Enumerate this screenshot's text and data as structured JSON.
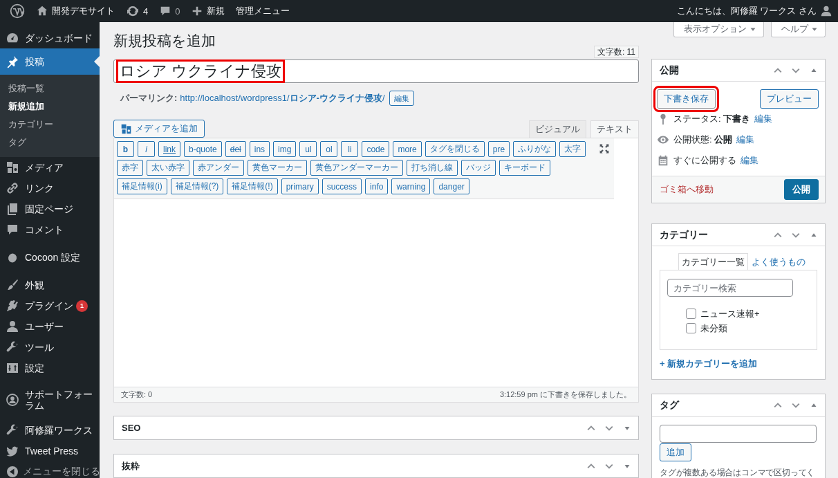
{
  "admin_bar": {
    "site_name": "開発デモサイト",
    "updates": "4",
    "comments": "0",
    "new": "新規",
    "admin_menu": "管理メニュー",
    "greeting": "こんにちは、阿修羅 ワークス さん"
  },
  "sidebar": {
    "items": [
      {
        "label": "ダッシュボード",
        "selected": false
      },
      {
        "label": "投稿",
        "selected": true,
        "children": [
          {
            "label": "投稿一覧",
            "selected": false
          },
          {
            "label": "新規追加",
            "selected": true
          },
          {
            "label": "カテゴリー",
            "selected": false
          },
          {
            "label": "タグ",
            "selected": false
          }
        ]
      },
      {
        "label": "メディア",
        "selected": false
      },
      {
        "label": "リンク",
        "selected": false
      },
      {
        "label": "固定ページ",
        "selected": false
      },
      {
        "label": "コメント",
        "selected": false
      },
      {
        "label": "Cocoon 設定",
        "selected": false
      },
      {
        "label": "外観",
        "selected": false
      },
      {
        "label": "プラグイン",
        "selected": false,
        "badge": "1"
      },
      {
        "label": "ユーザー",
        "selected": false
      },
      {
        "label": "ツール",
        "selected": false
      },
      {
        "label": "設定",
        "selected": false
      },
      {
        "label": "サポートフォーラム",
        "selected": false
      },
      {
        "label": "阿修羅ワークス",
        "selected": false
      },
      {
        "label": "Tweet Press",
        "selected": false
      },
      {
        "label": "メニューを閉じる",
        "selected": false
      }
    ]
  },
  "screen_options": [
    "表示オプション",
    "ヘルプ"
  ],
  "page_title": "新規投稿を追加",
  "title_field": {
    "char_count": "文字数: 11",
    "value": "ロシア ウクライナ侵攻",
    "highlighted": true
  },
  "permalink": {
    "label": "パーマリンク:",
    "url": "http://localhost/wordpress1/**ロシア-ウクライナ侵攻**/",
    "edit": "編集"
  },
  "add_media": "メディアを追加",
  "editor_tabs": [
    {
      "label": "ビジュアル",
      "selected": false
    },
    {
      "label": "テキスト",
      "selected": true
    }
  ],
  "quicktags": [
    {
      "label": "b",
      "kind": "bold"
    },
    {
      "label": "i",
      "kind": "italic"
    },
    {
      "label": "link",
      "kind": "underline"
    },
    {
      "label": "b-quote",
      "kind": "plain"
    },
    {
      "label": "del",
      "kind": "strike"
    },
    {
      "label": "ins",
      "kind": "plain"
    },
    {
      "label": "img",
      "kind": "plain"
    },
    {
      "label": "ul",
      "kind": "plain"
    },
    {
      "label": "ol",
      "kind": "plain"
    },
    {
      "label": "li",
      "kind": "plain"
    },
    {
      "label": "code",
      "kind": "plain"
    },
    {
      "label": "more",
      "kind": "plain"
    },
    {
      "label": "タグを閉じる",
      "kind": "plain"
    },
    {
      "label": "pre",
      "kind": "plain"
    },
    {
      "label": "ふりがな",
      "kind": "plain"
    },
    {
      "label": "太字",
      "kind": "plain"
    },
    {
      "label": "赤字",
      "kind": "plain"
    },
    {
      "label": "太い赤字",
      "kind": "plain"
    },
    {
      "label": "赤アンダー",
      "kind": "plain"
    },
    {
      "label": "黄色マーカー",
      "kind": "plain"
    },
    {
      "label": "黄色アンダーマーカー",
      "kind": "plain"
    },
    {
      "label": "打ち消し線",
      "kind": "plain"
    },
    {
      "label": "バッジ",
      "kind": "plain"
    },
    {
      "label": "キーボード",
      "kind": "plain"
    },
    {
      "label": "補足情報(i)",
      "kind": "plain"
    },
    {
      "label": "補足情報(?)",
      "kind": "plain"
    },
    {
      "label": "補足情報(!)",
      "kind": "plain"
    },
    {
      "label": "primary",
      "kind": "plain"
    },
    {
      "label": "success",
      "kind": "plain"
    },
    {
      "label": "info",
      "kind": "plain"
    },
    {
      "label": "warning",
      "kind": "plain"
    },
    {
      "label": "danger",
      "kind": "plain"
    }
  ],
  "word_count": "文字数: 0",
  "autosave": "3:12:59 pm に下書きを保存しました。",
  "postboxes": [
    {
      "title": "SEO"
    },
    {
      "title": "抜粋"
    }
  ],
  "publish": {
    "title": "公開",
    "save_draft": "下書き保存",
    "save_draft_highlighted": true,
    "preview": "プレビュー",
    "rows": [
      {
        "label": "ステータス:",
        "value": "下書き",
        "edit": "編集"
      },
      {
        "label": "公開状態:",
        "value": "公開",
        "edit": "編集"
      },
      {
        "label": "すぐに公開する",
        "edit": "編集"
      }
    ],
    "trash": "ゴミ箱へ移動",
    "publish": "公開"
  },
  "categories": {
    "title": "カテゴリー",
    "tabs": [
      {
        "label": "カテゴリー一覧",
        "selected": true
      },
      {
        "label": "よく使うもの",
        "selected": false
      }
    ],
    "search_placeholder": "カテゴリー検索",
    "items": [
      {
        "label": "ニュース速報+",
        "checked": false
      },
      {
        "label": "未分類",
        "checked": false
      }
    ],
    "add_new": "+ 新規カテゴリーを追加"
  },
  "tags": {
    "title": "タグ",
    "add": "追加",
    "help": "タグが複数ある場合はコンマで区切ってく"
  }
}
